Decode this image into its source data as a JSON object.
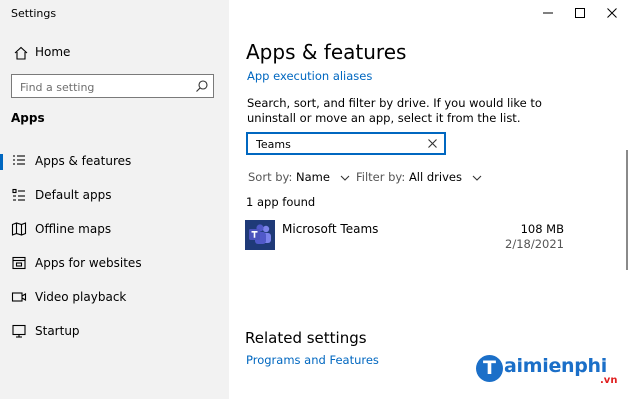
{
  "window": {
    "title": "Settings"
  },
  "sidebar": {
    "home_label": "Home",
    "search_placeholder": "Find a setting",
    "section_header": "Apps",
    "items": [
      {
        "label": "Apps & features",
        "icon": "list-icon",
        "active": true
      },
      {
        "label": "Default apps",
        "icon": "default-apps-icon",
        "active": false
      },
      {
        "label": "Offline maps",
        "icon": "map-icon",
        "active": false
      },
      {
        "label": "Apps for websites",
        "icon": "web-apps-icon",
        "active": false
      },
      {
        "label": "Video playback",
        "icon": "video-icon",
        "active": false
      },
      {
        "label": "Startup",
        "icon": "startup-icon",
        "active": false
      }
    ]
  },
  "main": {
    "title": "Apps & features",
    "execution_aliases_link": "App execution aliases",
    "description": "Search, sort, and filter by drive. If you would like to uninstall or move an app, select it from the list.",
    "search_value": "Teams",
    "sort_label": "Sort by:",
    "sort_value": "Name",
    "filter_label": "Filter by:",
    "filter_value": "All drives",
    "result_count": "1 app found",
    "apps": [
      {
        "name": "Microsoft Teams",
        "size": "108 MB",
        "date": "2/18/2021",
        "icon": "teams-icon"
      }
    ],
    "related_title": "Related settings",
    "programs_link": "Programs and Features"
  },
  "watermark": {
    "main": "aimienphi",
    "letter": "T",
    "sub": ".vn"
  },
  "colors": {
    "accent": "#0067c0",
    "sidebar_bg": "#f2f2f2",
    "teams": "#5059c9"
  }
}
